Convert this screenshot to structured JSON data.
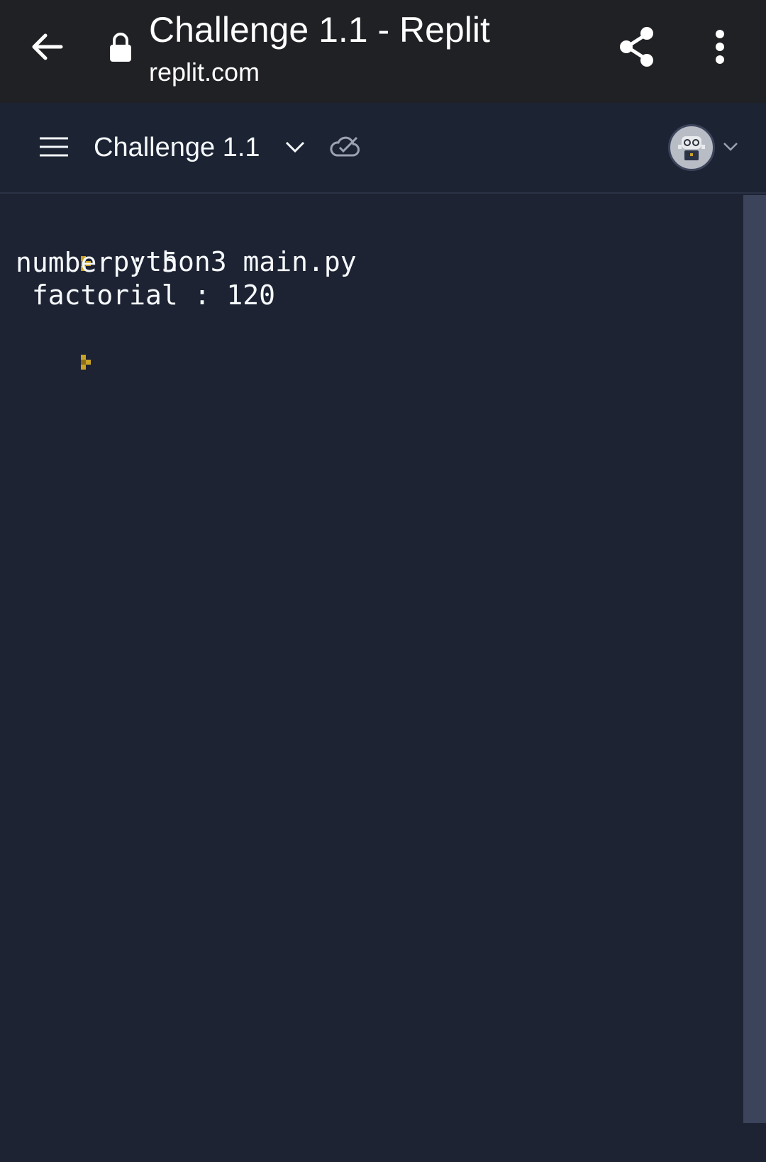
{
  "browser": {
    "title": "Challenge 1.1 - Replit",
    "url": "replit.com"
  },
  "header": {
    "repl_name": "Challenge 1.1"
  },
  "console": {
    "command": "python3 main.py",
    "lines": [
      "number : 5",
      " factorial : 120"
    ]
  },
  "colors": {
    "prompt_accent": "#c9a227",
    "background": "#1d2333",
    "scrollbar": "#3c445c"
  },
  "icons": {
    "back": "arrow-left-icon",
    "lock": "lock-icon",
    "share": "share-icon",
    "more": "more-vertical-icon",
    "menu": "hamburger-icon",
    "chevron": "chevron-down-icon",
    "saved": "cloud-check-icon",
    "avatar": "avatar-robot-icon",
    "prompt": "prompt-chevron-icon"
  }
}
